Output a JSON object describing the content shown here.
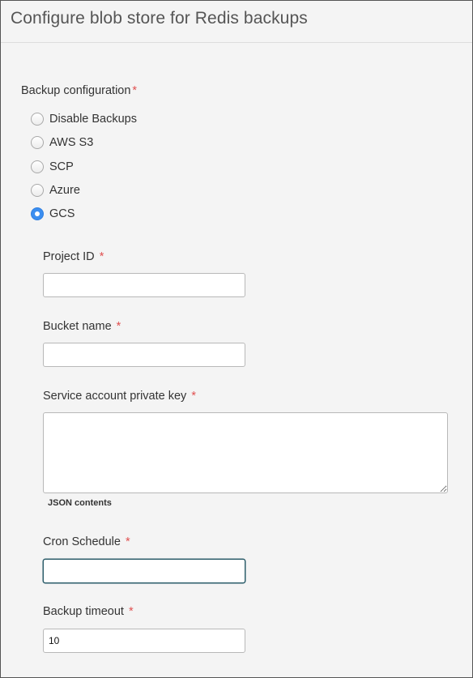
{
  "header": {
    "title": "Configure blob store for Redis backups"
  },
  "backup": {
    "label": "Backup configuration",
    "required_mark": "*",
    "options": [
      {
        "label": "Disable Backups",
        "checked": false
      },
      {
        "label": "AWS S3",
        "checked": false
      },
      {
        "label": "SCP",
        "checked": false
      },
      {
        "label": "Azure",
        "checked": false
      },
      {
        "label": "GCS",
        "checked": true
      }
    ]
  },
  "fields": {
    "project_id": {
      "label": "Project ID",
      "required_mark": "*",
      "value": ""
    },
    "bucket_name": {
      "label": "Bucket name",
      "required_mark": "*",
      "value": ""
    },
    "private_key": {
      "label": "Service account private key",
      "required_mark": "*",
      "value": "",
      "help": "JSON contents"
    },
    "cron_schedule": {
      "label": "Cron Schedule",
      "required_mark": "*",
      "value": ""
    },
    "backup_timeout": {
      "label": "Backup timeout",
      "required_mark": "*",
      "value": "10"
    }
  }
}
